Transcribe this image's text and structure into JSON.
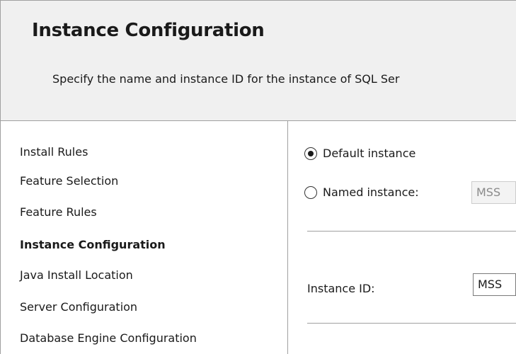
{
  "header": {
    "title": "Instance Configuration",
    "subtitle": "Specify the name and instance ID for the instance of SQL Ser"
  },
  "nav": {
    "items": [
      {
        "label": "Install Rules",
        "active": false
      },
      {
        "label": "Feature Selection",
        "active": false
      },
      {
        "label": "Feature Rules",
        "active": false
      },
      {
        "label": "Instance Configuration",
        "active": true
      },
      {
        "label": "Java Install Location",
        "active": false
      },
      {
        "label": "Server Configuration",
        "active": false
      },
      {
        "label": "Database Engine Configuration",
        "active": false
      }
    ]
  },
  "content": {
    "default_instance": {
      "label": "Default instance",
      "selected": true
    },
    "named_instance": {
      "label": "Named instance:",
      "selected": false,
      "value": "MSS"
    },
    "instance_id": {
      "label": "Instance ID:",
      "value": "MSS"
    }
  }
}
